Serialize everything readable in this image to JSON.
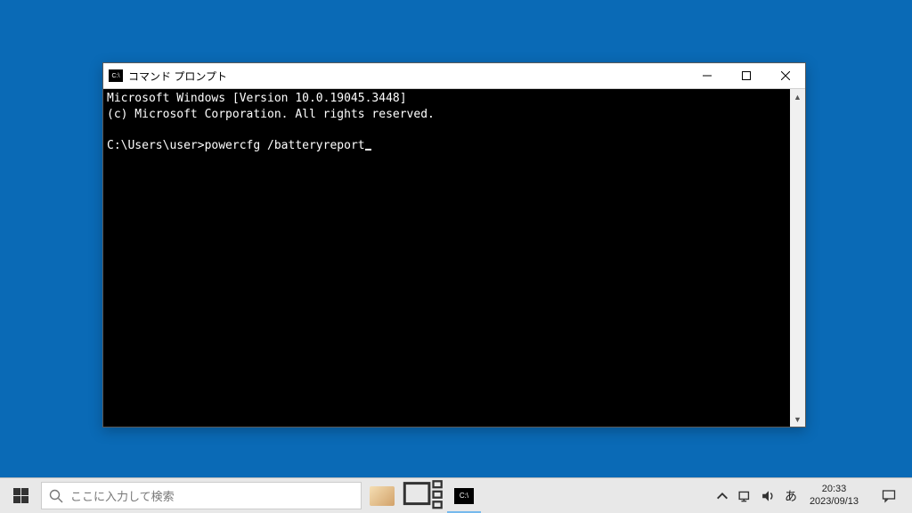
{
  "window": {
    "title": "コマンド プロンプト",
    "lines": {
      "l1": "Microsoft Windows [Version 10.0.19045.3448]",
      "l2": "(c) Microsoft Corporation. All rights reserved.",
      "l3": "",
      "prompt": "C:\\Users\\user>",
      "command": "powercfg /batteryreport"
    }
  },
  "taskbar": {
    "search_placeholder": "ここに入力して検索",
    "ime": "あ",
    "clock_time": "20:33",
    "clock_date": "2023/09/13"
  }
}
